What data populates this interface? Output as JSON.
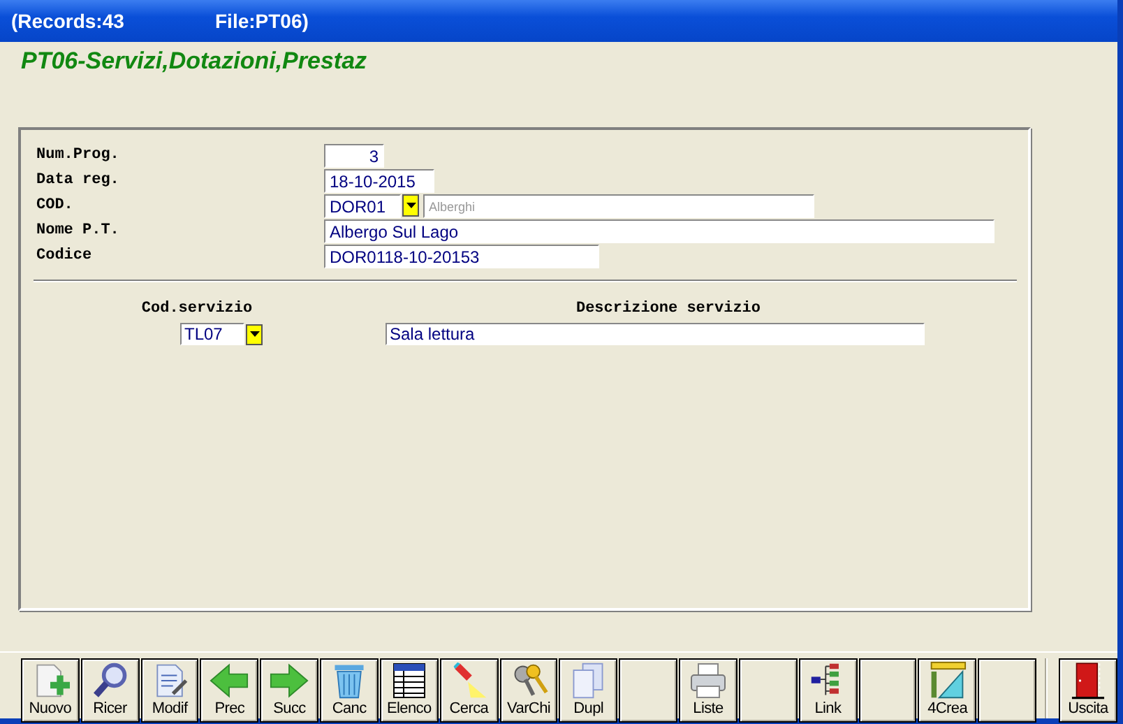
{
  "window": {
    "records": "(Records:43",
    "file": "File:PT06)"
  },
  "heading": "PT06-Servizi,Dotazioni,Prestaz",
  "fields": [
    {
      "kind": "number",
      "label": "Num.Prog.",
      "value": "3"
    },
    {
      "kind": "text",
      "label": "Data reg.",
      "value": "18-10-2015"
    },
    {
      "kind": "combo",
      "label": "COD.",
      "value": "DOR01",
      "lookup": "Alberghi"
    },
    {
      "kind": "text",
      "label": "Nome P.T.",
      "value": "Albergo Sul Lago"
    },
    {
      "kind": "text",
      "label": "Codice",
      "value": "DOR0118-10-20153"
    }
  ],
  "services": {
    "columns": [
      "Cod.servizio",
      "Descrizione servizio"
    ],
    "rows": [
      {
        "code": "TL07",
        "description": "Sala lettura"
      }
    ]
  },
  "toolbar": [
    {
      "kind": "action",
      "label": "Nuovo"
    },
    {
      "kind": "action",
      "label": "Ricer"
    },
    {
      "kind": "action",
      "label": "Modif"
    },
    {
      "kind": "action",
      "label": "Prec"
    },
    {
      "kind": "action",
      "label": "Succ"
    },
    {
      "kind": "action",
      "label": "Canc"
    },
    {
      "kind": "action",
      "label": "Elenco"
    },
    {
      "kind": "action",
      "label": "Cerca"
    },
    {
      "kind": "action",
      "label": "VarChi"
    },
    {
      "kind": "action",
      "label": "Dupl"
    },
    {
      "kind": "blank"
    },
    {
      "kind": "action",
      "label": "Liste"
    },
    {
      "kind": "blank"
    },
    {
      "kind": "action",
      "label": "Link"
    },
    {
      "kind": "blank"
    },
    {
      "kind": "action",
      "label": "4Crea"
    },
    {
      "kind": "blank"
    },
    {
      "kind": "exit",
      "label": "Uscita"
    }
  ]
}
